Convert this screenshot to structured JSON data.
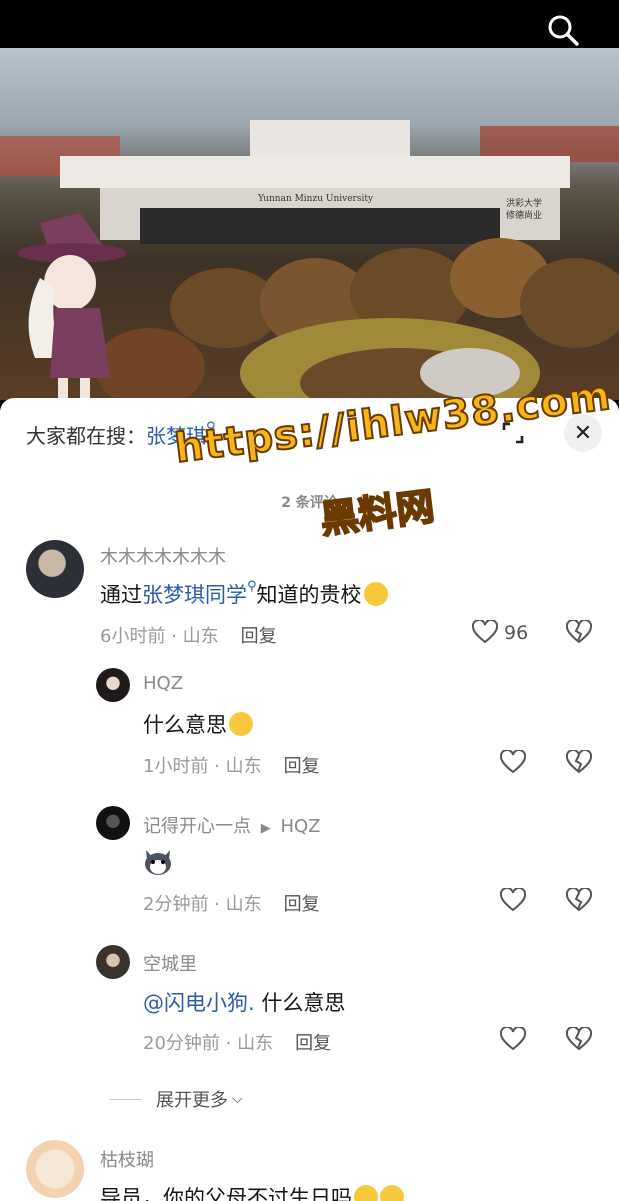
{
  "colors": {
    "link": "#2a5caa",
    "watermark": "#f6b51a"
  },
  "top_bar": {
    "search_icon": "search-icon"
  },
  "video": {
    "sign_text": "Yunnan Minzu University",
    "right_sign": "洪彩大学 修德尚业"
  },
  "sheet": {
    "hot_search_prefix": "大家都在搜：",
    "hot_search_keyword": "张梦琪",
    "comment_count": "2 条评论",
    "watermark_url": "https://ihlw38.com",
    "watermark_name": "黑料网"
  },
  "comments": [
    {
      "name": "木木木木木木木",
      "text_before": "通过",
      "link": "张梦琪同学",
      "text_after": "知道的贵校",
      "time_loc": "6小时前 · 山东",
      "reply": "回复",
      "likes": "96"
    },
    {
      "name": "HQZ",
      "text": "什么意思",
      "time_loc": "1小时前 · 山东",
      "reply": "回复"
    },
    {
      "name": "记得开心一点",
      "reply_to": "HQZ",
      "time_loc": "2分钟前 · 山东",
      "reply": "回复"
    },
    {
      "name": "空城里",
      "mention": "@闪电小狗.",
      "text": " 什么意思",
      "time_loc": "20分钟前 · 山东",
      "reply": "回复"
    },
    {
      "name": "枯枝瑚",
      "text": "导员，你的父母不过生日吗"
    }
  ],
  "expand_more": "展开更多"
}
